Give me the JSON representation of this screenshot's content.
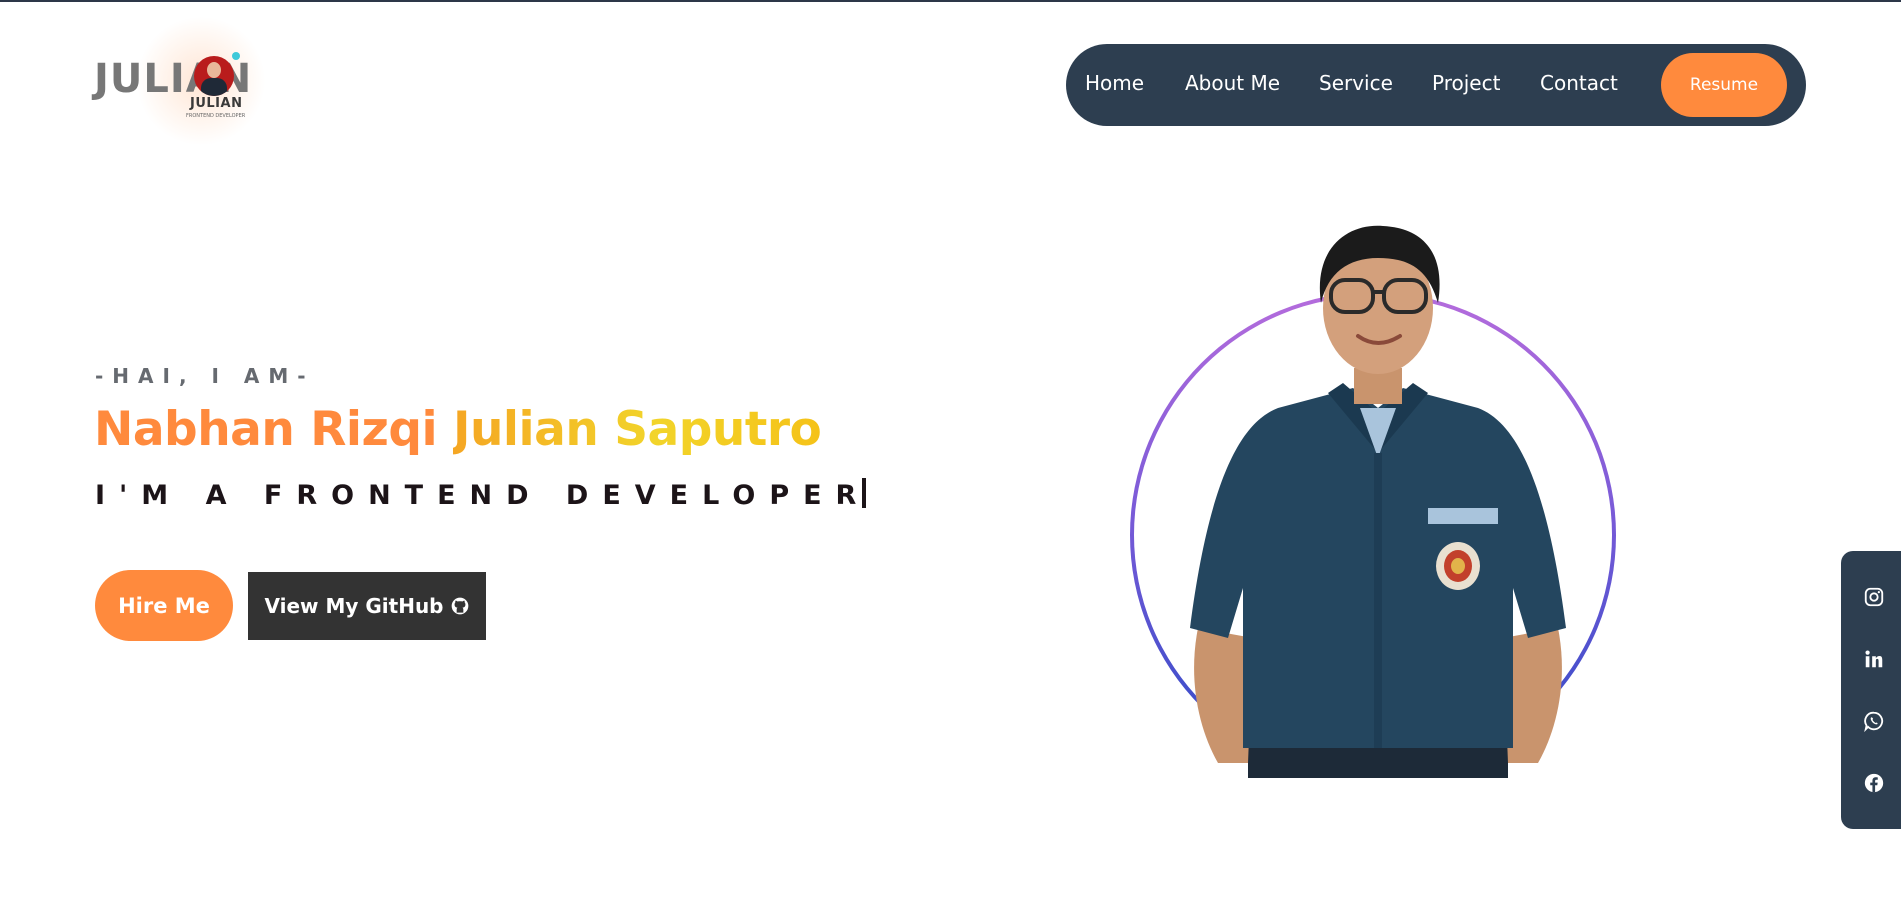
{
  "logo": {
    "word": "JULIAN",
    "badge_name": "JULIAN",
    "tagline": "FRONTEND DEVELOPER"
  },
  "nav": {
    "links": [
      "Home",
      "About Me",
      "Service",
      "Project",
      "Contact"
    ],
    "resume_label": "Resume"
  },
  "hero": {
    "greeting": "-HAI, I AM-",
    "name_part1": "Nabhan Rizqi",
    "name_part2": "Julian Saputro",
    "role": "I'M A FRONTEND DEVELOPER",
    "hire_label": "Hire Me",
    "github_label": "View My GitHub"
  },
  "social": {
    "icons": [
      "instagram-icon",
      "linkedin-icon",
      "whatsapp-icon",
      "facebook-icon"
    ]
  },
  "colors": {
    "accent": "#ff8a3d",
    "nav_bg": "#2d3e50",
    "name_gradient_start": "#f5a623",
    "name_gradient_end": "#f2d42a",
    "ring_top": "#b56cdc",
    "ring_bottom": "#2a49c6"
  }
}
